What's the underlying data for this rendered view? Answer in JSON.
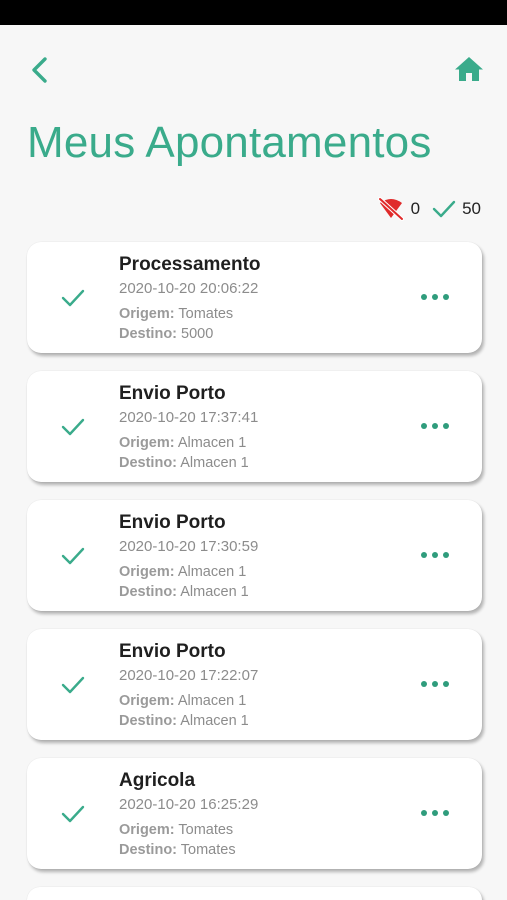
{
  "header": {
    "title": "Meus Apontamentos",
    "back_icon": "chevron-left-icon",
    "home_icon": "home-icon"
  },
  "counters": {
    "offline_icon": "wifi-off-icon",
    "offline_count": "0",
    "synced_icon": "check-icon",
    "synced_count": "50"
  },
  "labels": {
    "origin": "Origem:",
    "destination": "Destino:"
  },
  "colors": {
    "accent": "#3aab8b",
    "offline": "#e02a2a",
    "text": "#1f1f1f",
    "muted": "#8c8c8c"
  },
  "records": [
    {
      "title": "Processamento",
      "datetime": "2020-10-20 20:06:22",
      "origin": "Tomates",
      "destination": "5000"
    },
    {
      "title": "Envio Porto",
      "datetime": "2020-10-20 17:37:41",
      "origin": "Almacen 1",
      "destination": "Almacen 1"
    },
    {
      "title": "Envio Porto",
      "datetime": "2020-10-20 17:30:59",
      "origin": "Almacen 1",
      "destination": "Almacen 1"
    },
    {
      "title": "Envio Porto",
      "datetime": "2020-10-20 17:22:07",
      "origin": "Almacen 1",
      "destination": "Almacen 1"
    },
    {
      "title": "Agricola",
      "datetime": "2020-10-20 16:25:29",
      "origin": "Tomates",
      "destination": "Tomates"
    },
    {
      "title": "",
      "datetime": "",
      "origin": "",
      "destination": ""
    }
  ]
}
